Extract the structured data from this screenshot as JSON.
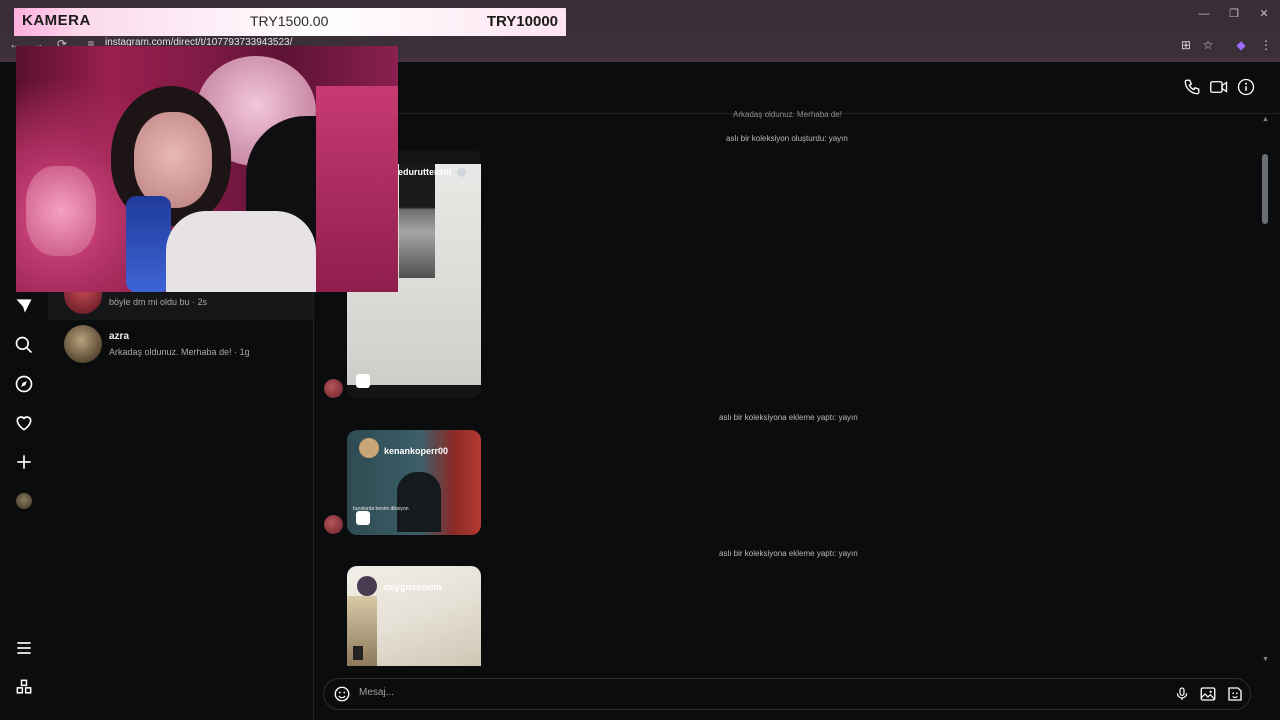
{
  "browser": {
    "url": "instagram.com/direct/t/107793733943523/",
    "controls": {
      "minimize": "—",
      "restore": "❐",
      "close": "✕"
    },
    "nav": {
      "back": "←",
      "forward": "→",
      "reload": "⟳",
      "site_info": "≡",
      "install": "⊞",
      "star": "☆",
      "extension": "◆",
      "menu": "⋮"
    }
  },
  "overlay": {
    "label": "KAMERA",
    "amount_current": "TRY1500.00",
    "amount_goal": "TRY10000"
  },
  "conversations": [
    {
      "preview": "böyle dm mi oldu bu · 2s"
    },
    {
      "name": "azra",
      "preview": "Arkadaş oldunuz. Merhaba de! · 1g"
    }
  ],
  "chat": {
    "system_messages": [
      "Arkadaş oldunuz. Merhaba de!",
      "aslı bir koleksiyon oluşturdu: yayın",
      "aslı bir koleksiyona ekleme yaptı: yayın",
      "aslı bir koleksiyona ekleme yaptı: yayın"
    ],
    "posts": [
      {
        "username": "edurutteкstil",
        "caption": ""
      },
      {
        "username": "kenankoperr00",
        "caption": "buralarda benim diksiyon"
      },
      {
        "username": "duygussevim",
        "caption": ""
      }
    ],
    "message_placeholder": "Mesaj..."
  },
  "icons": {
    "phone": "phone-icon",
    "video": "video-icon",
    "info": "info-icon"
  },
  "colors": {
    "background": "#0b0c0d",
    "browser_frame": "#3a2d37",
    "overlay_pink": "#ffb0de"
  }
}
